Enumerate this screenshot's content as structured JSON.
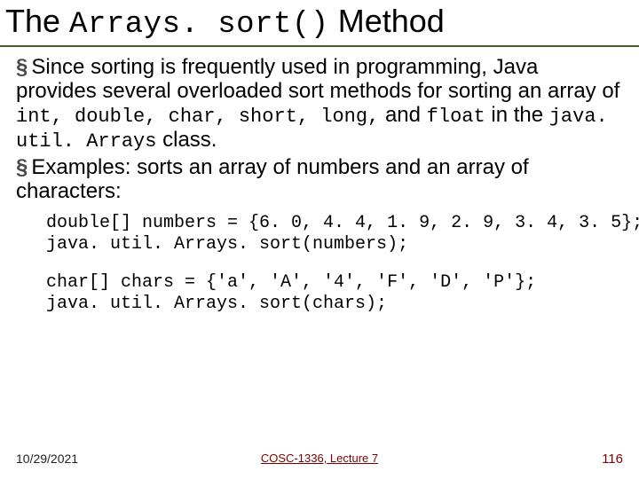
{
  "title": {
    "pre": "The ",
    "code": "Arrays. sort()",
    "post": " Method"
  },
  "paragraphs": {
    "p1": {
      "bullet": "§",
      "seg1": "Since sorting is frequently used in programming, Java provides several overloaded sort methods for sorting an array of ",
      "code1": "int, double, char, short, long,",
      "seg2": " and ",
      "code2": "float",
      "seg3": " in the ",
      "code3": "java. util. Arrays",
      "seg4": " class."
    },
    "p2": {
      "bullet": "§",
      "seg1": "Examples: sorts an array of numbers and an array of characters:"
    }
  },
  "code": {
    "l1": "double[] numbers = {6. 0, 4. 4, 1. 9, 2. 9, 3. 4, 3. 5};",
    "l2": "java. util. Arrays. sort(numbers);",
    "l3": "char[] chars = {'a', 'A', '4', 'F', 'D', 'P'};",
    "l4": "java. util. Arrays. sort(chars);"
  },
  "footer": {
    "date": "10/29/2021",
    "center": "COSC-1336, Lecture 7",
    "page": "116"
  },
  "colors": {
    "rule": "#4a5d23",
    "footer_accent": "#7a0000"
  }
}
